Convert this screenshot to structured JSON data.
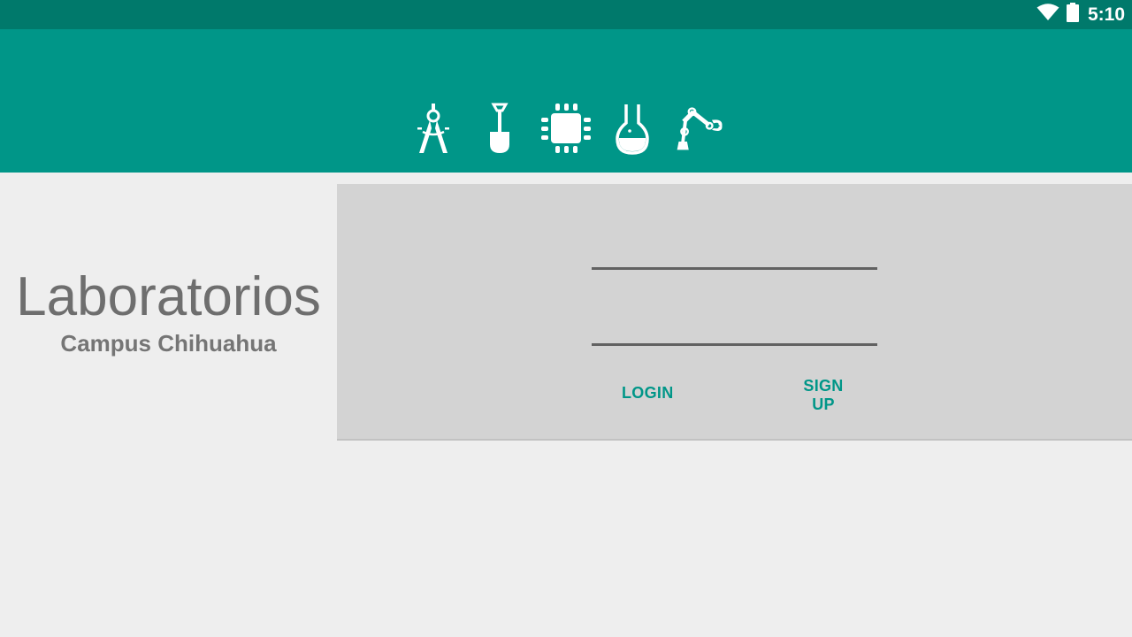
{
  "status_bar": {
    "time": "5:10",
    "icons": [
      "wifi-icon",
      "battery-icon"
    ],
    "color": "#00796b"
  },
  "app_bar": {
    "color": "#009688",
    "icons": [
      "drafting-compass-icon",
      "shovel-icon",
      "microchip-icon",
      "flask-icon",
      "robotic-arm-icon"
    ]
  },
  "brand": {
    "title": "Laboratorios",
    "subtitle": "Campus Chihuahua"
  },
  "login_form": {
    "username": {
      "value": "",
      "placeholder": ""
    },
    "password": {
      "value": "",
      "placeholder": ""
    },
    "login_label": "LOGIN",
    "signup_label": "SIGN UP",
    "accent_color": "#009688"
  }
}
